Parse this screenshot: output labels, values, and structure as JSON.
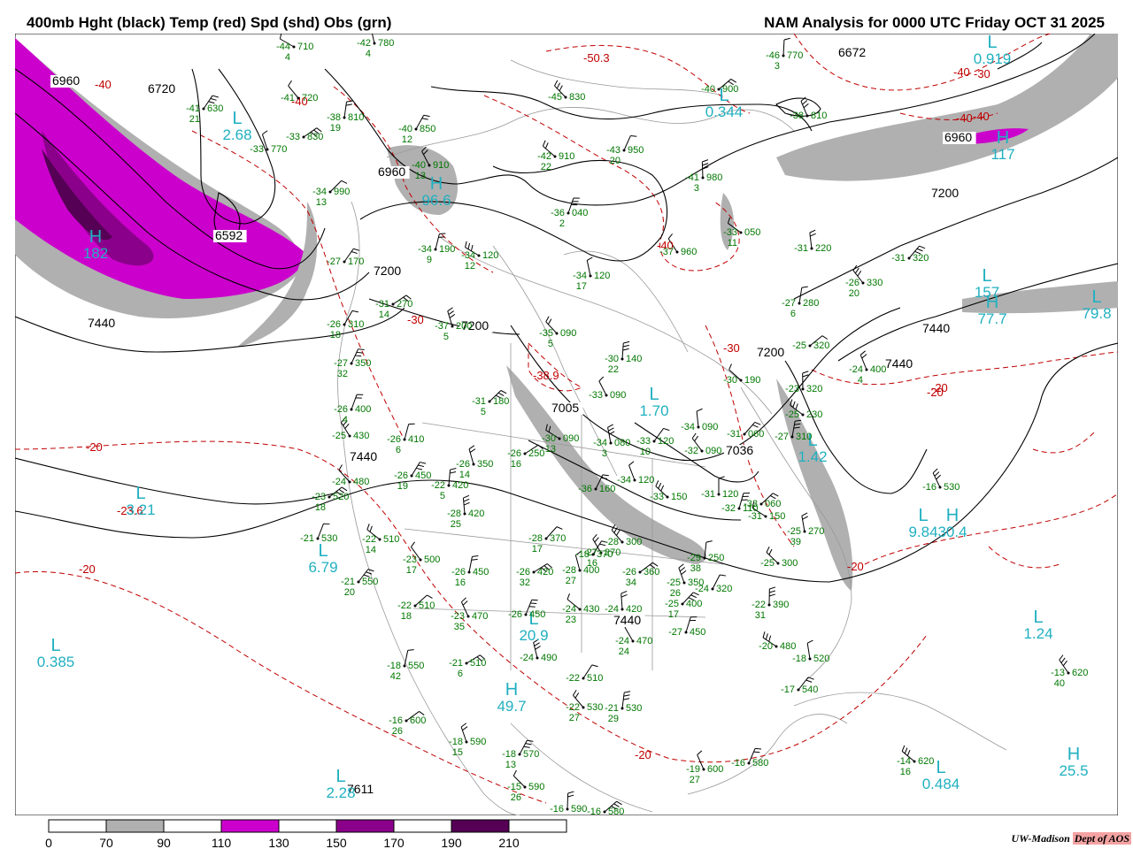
{
  "header": {
    "title_left": "400mb Hght (black) Temp (red) Spd (shd) Obs (grn)",
    "title_right": "NAM Analysis for 0000 UTC Friday  OCT 31 2025"
  },
  "colors": {
    "height_contour": "#000000",
    "temp_contour": "#c00000",
    "obs_text": "#007700",
    "center_label": "#20b0c0",
    "speed_70_90": "#b0b0b0",
    "speed_110_130": "#cc00cc",
    "speed_150_170": "#8b008b",
    "speed_190_210": "#550055",
    "boundaries": "#999999"
  },
  "legend": {
    "ticks": [
      "0",
      "70",
      "90",
      "110",
      "130",
      "150",
      "170",
      "190",
      "210"
    ],
    "fills": [
      "#ffffff",
      "#b0b0b0",
      "#ffffff",
      "#cc00cc",
      "#ffffff",
      "#8b008b",
      "#ffffff",
      "#550055",
      "#ffffff"
    ]
  },
  "credit": {
    "org": "UW-Madison",
    "dept": "Dept of AOS"
  },
  "height_labels": [
    "6960",
    "6720",
    "6592",
    "6960",
    "7200",
    "7200",
    "7005",
    "7440",
    "7440",
    "7200",
    "7440",
    "7440",
    "7200",
    "6960",
    "6672",
    "7440",
    "7611",
    "7036"
  ],
  "temp_labels": [
    "-40",
    "-40",
    "-30",
    "-20",
    "-20",
    "-20",
    "-30",
    "-40",
    "-40",
    "-40",
    "-30",
    "-20",
    "-20",
    "-20",
    "-38.9",
    "-23.6",
    "-40",
    "-50.3"
  ],
  "centers": [
    {
      "letter": "L",
      "value": "2.68"
    },
    {
      "letter": "H",
      "value": "182"
    },
    {
      "letter": "L",
      "value": "3.21"
    },
    {
      "letter": "L",
      "value": "6.79"
    },
    {
      "letter": "L",
      "value": "0.385"
    },
    {
      "letter": "L",
      "value": "2.28"
    },
    {
      "letter": "H",
      "value": "49.7"
    },
    {
      "letter": "L",
      "value": "20.9"
    },
    {
      "letter": "H",
      "value": "117"
    },
    {
      "letter": "L",
      "value": "0.919"
    },
    {
      "letter": "L",
      "value": "0.344"
    },
    {
      "letter": "L",
      "value": "157"
    },
    {
      "letter": "H",
      "value": "77.7"
    },
    {
      "letter": "L",
      "value": "79.8"
    },
    {
      "letter": "L",
      "value": "1.24"
    },
    {
      "letter": "H",
      "value": "25.5"
    },
    {
      "letter": "L",
      "value": "0.484"
    },
    {
      "letter": "H",
      "value": "96.6"
    },
    {
      "letter": "L",
      "value": "1.70"
    },
    {
      "letter": "L",
      "value": "9.84"
    },
    {
      "letter": "H",
      "value": "30.4"
    },
    {
      "letter": "L",
      "value": "1.42"
    }
  ],
  "observations": [
    {
      "t": "-44",
      "d": "4",
      "h": "710"
    },
    {
      "t": "-42",
      "d": "4",
      "h": "780"
    },
    {
      "t": "-41",
      "d": "21",
      "h": "630"
    },
    {
      "t": "-41",
      "d": "",
      "h": "720"
    },
    {
      "t": "-38",
      "d": "19",
      "h": "810"
    },
    {
      "t": "-33",
      "d": "",
      "h": "830"
    },
    {
      "t": "-33",
      "d": "",
      "h": "770"
    },
    {
      "t": "-40",
      "d": "12",
      "h": "850"
    },
    {
      "t": "-45",
      "d": "",
      "h": "830"
    },
    {
      "t": "-46",
      "d": "3",
      "h": "770"
    },
    {
      "t": "-40",
      "d": "",
      "h": "900"
    },
    {
      "t": "-38",
      "d": "",
      "h": "810"
    },
    {
      "t": "-43",
      "d": "20",
      "h": "950"
    },
    {
      "t": "-42",
      "d": "22",
      "h": "910"
    },
    {
      "t": "-41",
      "d": "3",
      "h": "980"
    },
    {
      "t": "-34",
      "d": "13",
      "h": "990"
    },
    {
      "t": "-40",
      "d": "13",
      "h": "910"
    },
    {
      "t": "-36",
      "d": "2",
      "h": "040"
    },
    {
      "t": "-33",
      "d": "11",
      "h": "050"
    },
    {
      "t": "-31",
      "d": "",
      "h": "220"
    },
    {
      "t": "-31",
      "d": "",
      "h": "320"
    },
    {
      "t": "-37",
      "d": "",
      "h": "960"
    },
    {
      "t": "-34",
      "d": "9",
      "h": "190"
    },
    {
      "t": "-34",
      "d": "12",
      "h": "120"
    },
    {
      "t": "-34",
      "d": "17",
      "h": "120"
    },
    {
      "t": "-27",
      "d": "",
      "h": "170"
    },
    {
      "t": "-26",
      "d": "20",
      "h": "330"
    },
    {
      "t": "-27",
      "d": "6",
      "h": "280"
    },
    {
      "t": "-31",
      "d": "14",
      "h": "270"
    },
    {
      "t": "-37",
      "d": "5",
      "h": "200"
    },
    {
      "t": "-26",
      "d": "18",
      "h": "310"
    },
    {
      "t": "-35",
      "d": "5",
      "h": "090"
    },
    {
      "t": "-30",
      "d": "22",
      "h": "140"
    },
    {
      "t": "-25",
      "d": "",
      "h": "320"
    },
    {
      "t": "-24",
      "d": "4",
      "h": "400"
    },
    {
      "t": "-27",
      "d": "32",
      "h": "350"
    },
    {
      "t": "-30",
      "d": "",
      "h": "190"
    },
    {
      "t": "-23",
      "d": "",
      "h": "320"
    },
    {
      "t": "-31",
      "d": "5",
      "h": "180"
    },
    {
      "t": "-33",
      "d": "",
      "h": "090"
    },
    {
      "t": "-26",
      "d": "4",
      "h": "400"
    },
    {
      "t": "-25",
      "d": "",
      "h": "230"
    },
    {
      "t": "-34",
      "d": "",
      "h": "090"
    },
    {
      "t": "-31",
      "d": "",
      "h": "060"
    },
    {
      "t": "-25",
      "d": "",
      "h": "430"
    },
    {
      "t": "-26",
      "d": "6",
      "h": "410"
    },
    {
      "t": "-30",
      "d": "13",
      "h": "090"
    },
    {
      "t": "-34",
      "d": "3",
      "h": "080"
    },
    {
      "t": "-33",
      "d": "10",
      "h": "120"
    },
    {
      "t": "-32",
      "d": "",
      "h": "090"
    },
    {
      "t": "-27",
      "d": "",
      "h": "310"
    },
    {
      "t": "-26",
      "d": "16",
      "h": "250"
    },
    {
      "t": "-26",
      "d": "14",
      "h": "350"
    },
    {
      "t": "-26",
      "d": "19",
      "h": "450"
    },
    {
      "t": "-24",
      "d": "",
      "h": "480"
    },
    {
      "t": "-22",
      "d": "5",
      "h": "420"
    },
    {
      "t": "-23",
      "d": "18",
      "h": "520"
    },
    {
      "t": "-34",
      "d": "",
      "h": "120"
    },
    {
      "t": "-36",
      "d": "",
      "h": "160"
    },
    {
      "t": "-33",
      "d": "",
      "h": "150"
    },
    {
      "t": "-31",
      "d": "",
      "h": "120"
    },
    {
      "t": "-33",
      "d": "",
      "h": "060"
    },
    {
      "t": "-16",
      "d": "",
      "h": "530"
    },
    {
      "t": "-21",
      "d": "",
      "h": "530"
    },
    {
      "t": "-22",
      "d": "14",
      "h": "510"
    },
    {
      "t": "-28",
      "d": "25",
      "h": "420"
    },
    {
      "t": "-28",
      "d": "17",
      "h": "370"
    },
    {
      "t": "-27",
      "d": "16",
      "h": "270"
    },
    {
      "t": "-32",
      "d": "",
      "h": "110"
    },
    {
      "t": "-31",
      "d": "",
      "h": "150"
    },
    {
      "t": "-25",
      "d": "39",
      "h": "270"
    },
    {
      "t": "-21",
      "d": "20",
      "h": "550"
    },
    {
      "t": "-23",
      "d": "17",
      "h": "500"
    },
    {
      "t": "-26",
      "d": "16",
      "h": "450"
    },
    {
      "t": "-26",
      "d": "32",
      "h": "420"
    },
    {
      "t": "-28",
      "d": "27",
      "h": "400"
    },
    {
      "t": "-18",
      "d": "",
      "h": "370"
    },
    {
      "t": "-28",
      "d": "",
      "h": "300"
    },
    {
      "t": "-29",
      "d": "38",
      "h": "250"
    },
    {
      "t": "-26",
      "d": "34",
      "h": "360"
    },
    {
      "t": "-25",
      "d": "26",
      "h": "350"
    },
    {
      "t": "-24",
      "d": "",
      "h": "320"
    },
    {
      "t": "-25",
      "d": "",
      "h": "300"
    },
    {
      "t": "-22",
      "d": "31",
      "h": "390"
    },
    {
      "t": "-22",
      "d": "18",
      "h": "510"
    },
    {
      "t": "-23",
      "d": "35",
      "h": "470"
    },
    {
      "t": "-26",
      "d": "",
      "h": "450"
    },
    {
      "t": "-24",
      "d": "23",
      "h": "430"
    },
    {
      "t": "-24",
      "d": "",
      "h": "420"
    },
    {
      "t": "-25",
      "d": "17",
      "h": "400"
    },
    {
      "t": "-24",
      "d": "24",
      "h": "470"
    },
    {
      "t": "-27",
      "d": "",
      "h": "450"
    },
    {
      "t": "-20",
      "d": "",
      "h": "480"
    },
    {
      "t": "-18",
      "d": "",
      "h": "520"
    },
    {
      "t": "-17",
      "d": "",
      "h": "540"
    },
    {
      "t": "-13",
      "d": "40",
      "h": "620"
    },
    {
      "t": "-18",
      "d": "42",
      "h": "550"
    },
    {
      "t": "-21",
      "d": "6",
      "h": "510"
    },
    {
      "t": "-24",
      "d": "",
      "h": "490"
    },
    {
      "t": "-22",
      "d": "",
      "h": "510"
    },
    {
      "t": "-22",
      "d": "27",
      "h": "530"
    },
    {
      "t": "-21",
      "d": "29",
      "h": "530"
    },
    {
      "t": "-16",
      "d": "26",
      "h": "600"
    },
    {
      "t": "-18",
      "d": "15",
      "h": "590"
    },
    {
      "t": "-18",
      "d": "13",
      "h": "570"
    },
    {
      "t": "-15",
      "d": "26",
      "h": "590"
    },
    {
      "t": "-16",
      "d": "",
      "h": "590"
    },
    {
      "t": "-16",
      "d": "",
      "h": "580"
    },
    {
      "t": "-19",
      "d": "27",
      "h": "600"
    },
    {
      "t": "-16",
      "d": "",
      "h": "580"
    },
    {
      "t": "-14",
      "d": "16",
      "h": "620"
    }
  ]
}
